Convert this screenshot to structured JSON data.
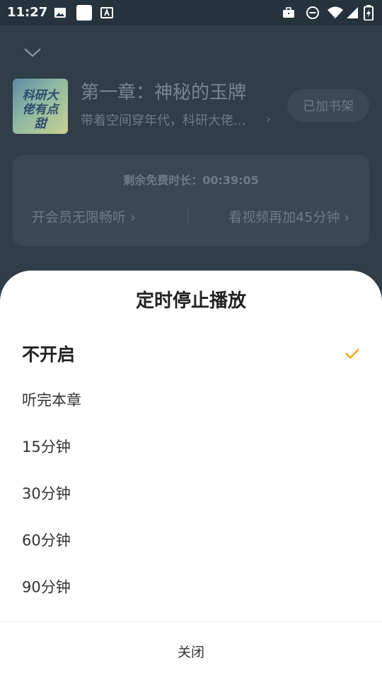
{
  "status_bar": {
    "time": "11:27",
    "left_icons": [
      "image-icon",
      "blank-square-icon",
      "font-icon"
    ],
    "right_icons": [
      "briefcase-icon",
      "dnd-icon",
      "wifi-icon",
      "signal-icon",
      "battery-icon"
    ]
  },
  "player": {
    "chapter_title": "第一章：神秘的玉牌",
    "book_subtitle": "带着空间穿年代，科研大佬...",
    "cover_text": "科研大佬有点甜",
    "shelf_button": "已加书架",
    "free_time_label": "剩余免费时长：00:39:05",
    "vip_link": "开会员无限畅听",
    "video_link": "看视频再加45分钟"
  },
  "sheet": {
    "title": "定时停止播放",
    "options": [
      {
        "label": "不开启",
        "selected": true
      },
      {
        "label": "听完本章",
        "selected": false
      },
      {
        "label": "15分钟",
        "selected": false
      },
      {
        "label": "30分钟",
        "selected": false
      },
      {
        "label": "60分钟",
        "selected": false
      },
      {
        "label": "90分钟",
        "selected": false
      }
    ],
    "close_label": "关闭",
    "accent_color": "#f5a623"
  }
}
